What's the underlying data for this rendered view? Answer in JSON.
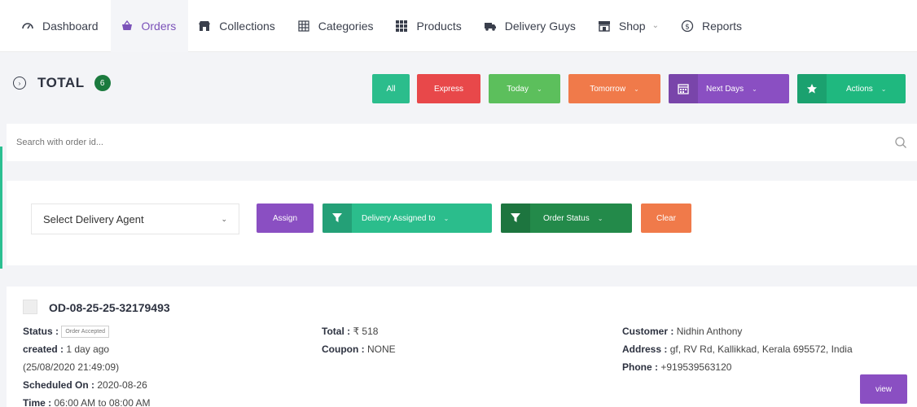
{
  "nav": {
    "items": [
      {
        "label": "Dashboard",
        "icon": "dashboard-gauge-icon"
      },
      {
        "label": "Orders",
        "icon": "basket-icon"
      },
      {
        "label": "Collections",
        "icon": "store-icon"
      },
      {
        "label": "Categories",
        "icon": "grid-icon"
      },
      {
        "label": "Products",
        "icon": "grid-dots-icon"
      },
      {
        "label": "Delivery Guys",
        "icon": "truck-icon"
      },
      {
        "label": "Shop",
        "icon": "shop-icon"
      },
      {
        "label": "Reports",
        "icon": "dollar-circle-icon"
      }
    ],
    "active_index": 1
  },
  "total": {
    "label": "TOTAL",
    "count": "6"
  },
  "filters": {
    "all": "All",
    "express": "Express",
    "today": "Today",
    "tomorrow": "Tomorrow",
    "next_days": "Next Days",
    "actions": "Actions"
  },
  "search": {
    "placeholder": "Search with order id..."
  },
  "panel": {
    "select_label": "Select Delivery Agent",
    "assign": "Assign",
    "delivery_assigned_to": "Delivery Assigned to",
    "order_status": "Order Status",
    "clear": "Clear"
  },
  "order": {
    "id": "OD-08-25-25-32179493",
    "status_label": "Status :",
    "status_value": "Order Accepted",
    "created_label": "created :",
    "created_value": "1 day ago",
    "created_datetime": "(25/08/2020 21:49:09)",
    "scheduled_label": "Scheduled On :",
    "scheduled_value": "2020-08-26",
    "time_label": "Time :",
    "time_value": "06:00 AM to 08:00 AM",
    "total_label": "Total :",
    "total_value": "₹ 518",
    "coupon_label": "Coupon :",
    "coupon_value": "NONE",
    "customer_label": "Customer :",
    "customer_value": "Nidhin Anthony",
    "address_label": "Address :",
    "address_value": "gf, RV Rd, Kallikkad, Kerala 695572, India",
    "phone_label": "Phone :",
    "phone_value": "+919539563120",
    "view": "view"
  },
  "colors": {
    "green": "#2bbd8c",
    "red": "#e8484a",
    "light_green": "#5cbf5c",
    "orange": "#f07a4a",
    "purple": "#8a4fc2",
    "teal": "#1fb87f",
    "dark_green": "#238a4a",
    "badge_green": "#1b7a3e"
  }
}
